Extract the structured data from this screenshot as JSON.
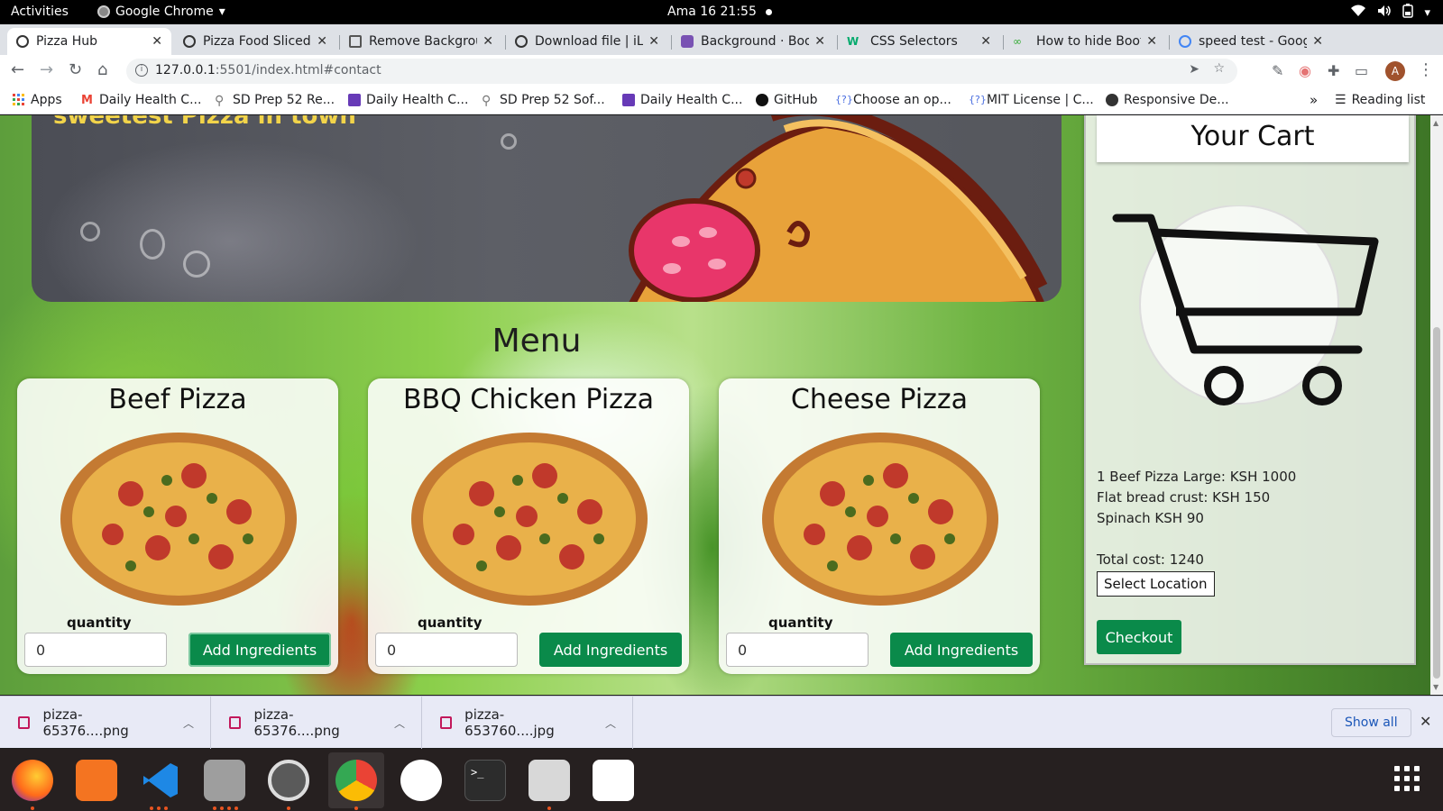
{
  "system": {
    "activities": "Activities",
    "app_name": "Google Chrome",
    "clock": "Ama 16  21:55"
  },
  "tabs": [
    {
      "title": "Pizza Hub",
      "active": true
    },
    {
      "title": "Pizza Food Sliced",
      "active": false
    },
    {
      "title": "Remove Backgrou",
      "active": false
    },
    {
      "title": "Download file | iL",
      "active": false
    },
    {
      "title": "Background · Boo",
      "active": false
    },
    {
      "title": "CSS Selectors",
      "active": false
    },
    {
      "title": "How to hide Boot",
      "active": false
    },
    {
      "title": "speed test - Goog",
      "active": false
    }
  ],
  "toolbar": {
    "url_host": "127.0.0.1",
    "url_path": ":5501/index.html#contact",
    "avatar_letter": "A"
  },
  "bookmarks": [
    {
      "label": "Apps",
      "icon": "apps-grid-icon"
    },
    {
      "label": "Daily Health C...",
      "icon": "gmail-icon"
    },
    {
      "label": "SD Prep 52 Re...",
      "icon": "pin-icon"
    },
    {
      "label": "Daily Health C...",
      "icon": "form-icon"
    },
    {
      "label": "SD Prep 52 Sof...",
      "icon": "pin-icon"
    },
    {
      "label": "Daily Health C...",
      "icon": "form-icon"
    },
    {
      "label": "GitHub",
      "icon": "github-icon"
    },
    {
      "label": "Choose an op...",
      "icon": "code-icon"
    },
    {
      "label": "MIT License | C...",
      "icon": "code-icon"
    },
    {
      "label": "Responsive De...",
      "icon": "globe-icon"
    }
  ],
  "reading_list": "Reading list",
  "page": {
    "hero_tagline": "sweetest Pizza in town",
    "menu_title": "Menu",
    "cards": [
      {
        "title": "Beef Pizza",
        "quantity_label": "quantity",
        "quantity_value": "0",
        "button": "Add Ingredients"
      },
      {
        "title": "BBQ Chicken Pizza",
        "quantity_label": "quantity",
        "quantity_value": "0",
        "button": "Add Ingredients"
      },
      {
        "title": "Cheese Pizza",
        "quantity_label": "quantity",
        "quantity_value": "0",
        "button": "Add Ingredients"
      }
    ],
    "cart": {
      "title": "Your Cart",
      "lines": [
        "1 Beef Pizza Large: KSH 1000",
        "Flat bread crust: KSH 150",
        "Spinach KSH 90"
      ],
      "total": "Total cost: 1240",
      "select_location": "Select Location",
      "checkout": "Checkout"
    }
  },
  "downloads": {
    "items": [
      "pizza-65376....png",
      "pizza-65376....png",
      "pizza-653760....jpg"
    ],
    "show_all": "Show all"
  },
  "colors": {
    "accent_green": "#0a8a4a",
    "hero_text": "#f2d44a"
  }
}
